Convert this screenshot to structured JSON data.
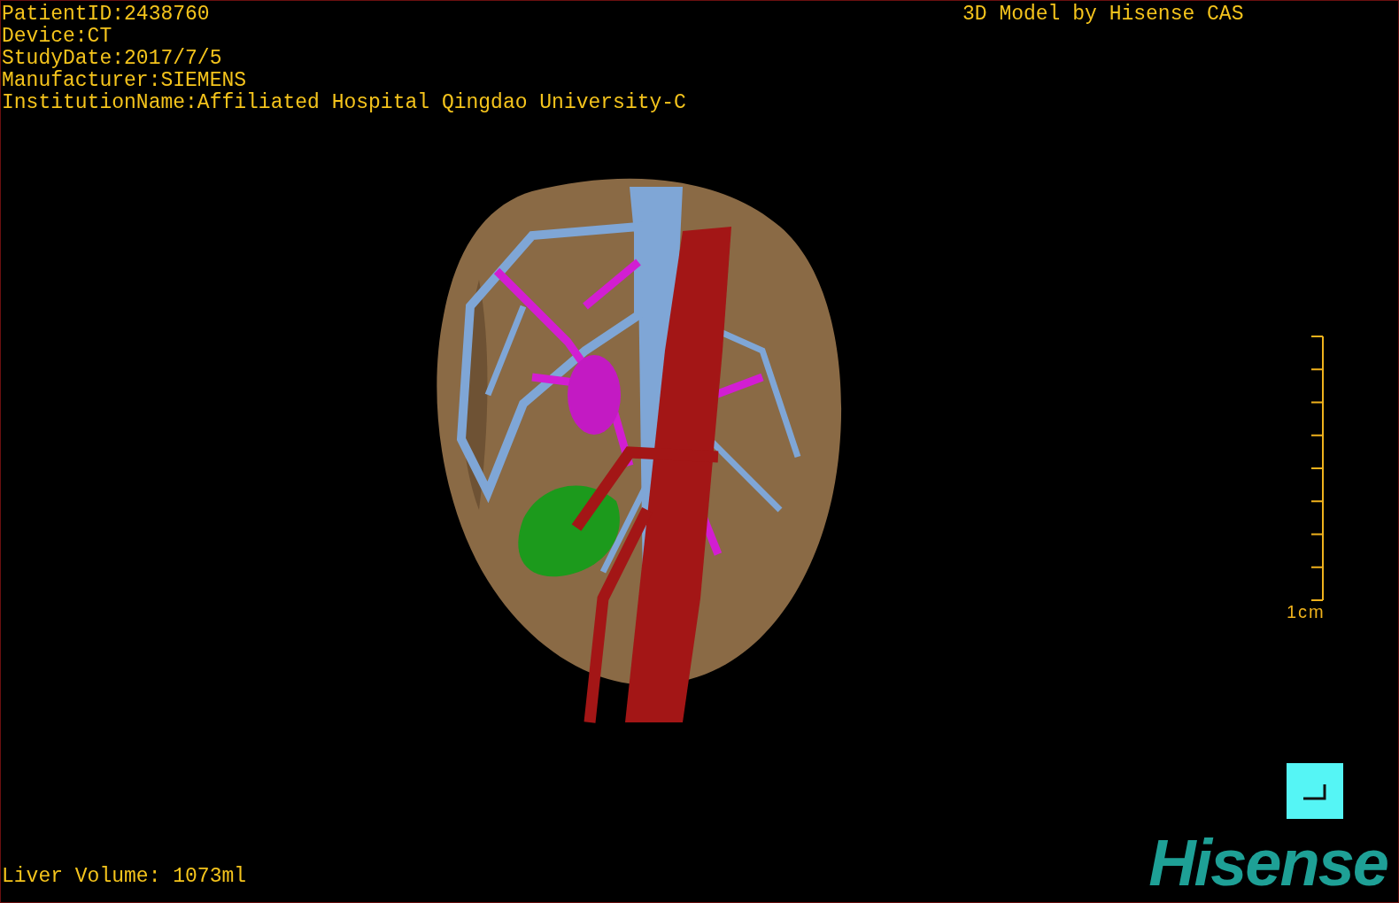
{
  "patient_info": [
    "PatientID:2438760",
    "Device:CT",
    "StudyDate:2017/7/5",
    "Manufacturer:SIEMENS",
    "InstitutionName:Affiliated Hospital Qingdao University-C"
  ],
  "title": "3D Model by Hisense CAS",
  "scale_bar": {
    "label": "1cm"
  },
  "liver_volume": "Liver Volume: 1073ml",
  "logo": "Hisense"
}
